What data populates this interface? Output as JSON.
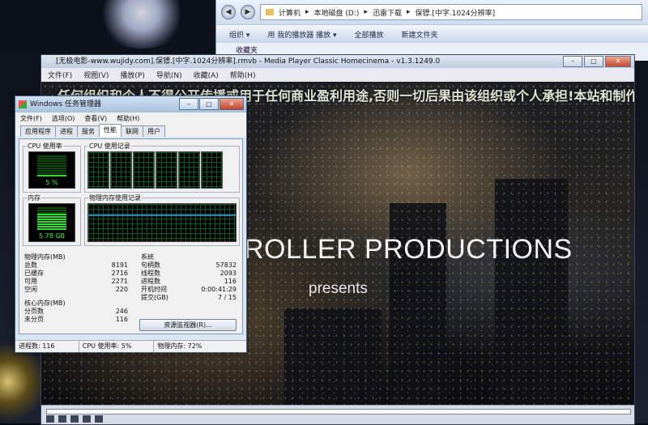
{
  "explorer": {
    "breadcrumb": [
      "计算机",
      "本地磁盘 (D:)",
      "迅雷下载",
      "保镖.[中字.1024分辨率]"
    ],
    "toolbar": [
      "组织 ▾",
      "用 我的播放器 播放 ▾",
      "全部播放",
      "新建文件夹"
    ],
    "side_item": "收藏夹"
  },
  "player": {
    "title": "[无极电影-www.wujidy.com].保镖.[中字.1024分辨率].rmvb - Media Player Classic Homecinema - v1.3.1249.0",
    "menu": [
      "文件(F)",
      "视图(V)",
      "播放(P)",
      "导航(N)",
      "收藏(A)",
      "帮助(H)"
    ],
    "banner": "任何组织和个人不得公开传播或用于任何商业盈利用途,否则一切后果由该组织或个人承担!本站和制作",
    "video_title": "ROLLER PRODUCTIONS",
    "video_subtitle": "presents"
  },
  "taskmgr": {
    "title": "Windows 任务管理器",
    "menu": [
      "文件(F)",
      "选项(O)",
      "查看(V)",
      "帮助(H)"
    ],
    "tabs": [
      "应用程序",
      "进程",
      "服务",
      "性能",
      "联网",
      "用户"
    ],
    "active_tab": "性能",
    "cpu_usage_label": "CPU 使用率",
    "cpu_usage_value": "5 %",
    "cpu_usage_fraction": 0.05,
    "cpu_history_label": "CPU 使用记录",
    "mem_label": "内存",
    "mem_value": "5.78 GB",
    "mem_fraction": 0.72,
    "mem_history_label": "物理内存使用记录",
    "physical_mem": {
      "label": "物理内存(MB)",
      "rows": [
        {
          "k": "总数",
          "v": "8191"
        },
        {
          "k": "已缓存",
          "v": "2716"
        },
        {
          "k": "可用",
          "v": "2271"
        },
        {
          "k": "空闲",
          "v": "220"
        }
      ]
    },
    "kernel_mem": {
      "label": "核心内存(MB)",
      "rows": [
        {
          "k": "分页数",
          "v": "246"
        },
        {
          "k": "未分页",
          "v": "116"
        }
      ]
    },
    "system": {
      "label": "系统",
      "rows": [
        {
          "k": "句柄数",
          "v": "57832"
        },
        {
          "k": "线程数",
          "v": "2093"
        },
        {
          "k": "进程数",
          "v": "116"
        },
        {
          "k": "开机时间",
          "v": "0:00:41:29"
        },
        {
          "k": "提交(GB)",
          "v": "7 / 15"
        }
      ]
    },
    "resource_monitor_button": "资源监视器(R)...",
    "status": {
      "processes": "进程数: 116",
      "cpu": "CPU 使用率: 5%",
      "memory": "物理内存: 72%"
    }
  }
}
